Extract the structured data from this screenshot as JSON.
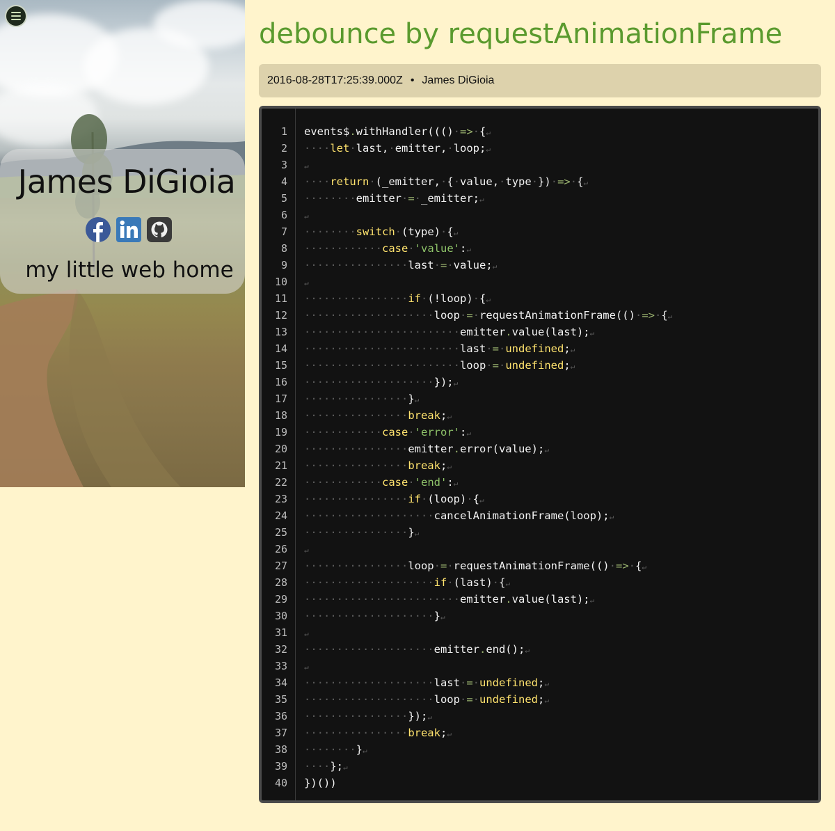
{
  "sidebar": {
    "menu_icon": "hamburger-menu-icon",
    "name": "James DiGioia",
    "tagline": "my little web home",
    "social": [
      {
        "icon": "facebook-icon",
        "color": "#3b5998"
      },
      {
        "icon": "linkedin-icon",
        "color": "#0e76a8"
      },
      {
        "icon": "github-icon",
        "color": "#333333"
      }
    ]
  },
  "post": {
    "title": "debounce by requestAnimationFrame",
    "date": "2016-08-28T17:25:39.000Z",
    "separator": "•",
    "author": "James DiGioia"
  },
  "code": {
    "language": "javascript",
    "lines": [
      "events$.withHandler((() => {",
      "    let last, emitter, loop;",
      "",
      "    return (_emitter, { value, type }) => {",
      "        emitter = _emitter;",
      "",
      "        switch (type) {",
      "            case 'value':",
      "                last = value;",
      "",
      "                if (!loop) {",
      "                    loop = requestAnimationFrame(() => {",
      "                        emitter.value(last);",
      "                        last = undefined;",
      "                        loop = undefined;",
      "                    });",
      "                }",
      "                break;",
      "            case 'error':",
      "                emitter.error(value);",
      "                break;",
      "            case 'end':",
      "                if (loop) {",
      "                    cancelAnimationFrame(loop);",
      "                }",
      "",
      "                loop = requestAnimationFrame(() => {",
      "                    if (last) {",
      "                        emitter.value(last);",
      "                    }",
      "",
      "                    emitter.end();",
      "",
      "                    last = undefined;",
      "                    loop = undefined;",
      "                });",
      "                break;",
      "        }",
      "    };",
      "})())"
    ]
  },
  "colors": {
    "background": "#fff4cc",
    "title": "#5a9a2e",
    "meta_bar": "#ddd2ac",
    "code_bg": "#121212",
    "keyword": "#ffe36e",
    "string": "#8fc46a"
  }
}
